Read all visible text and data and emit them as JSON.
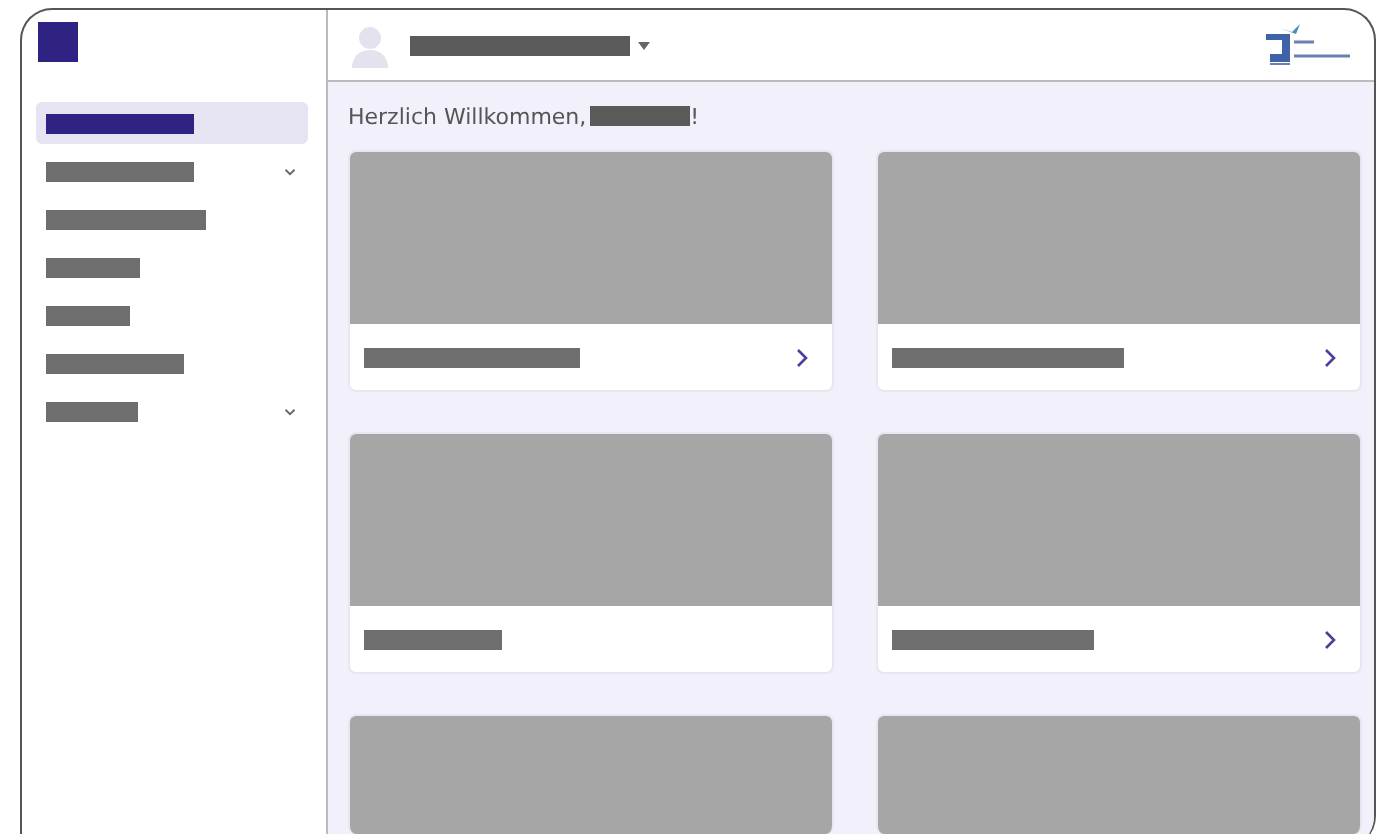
{
  "sidebar": {
    "items": [
      {
        "selected": true,
        "expandable": false
      },
      {
        "selected": false,
        "expandable": true
      },
      {
        "selected": false,
        "expandable": false
      },
      {
        "selected": false,
        "expandable": false
      },
      {
        "selected": false,
        "expandable": false
      },
      {
        "selected": false,
        "expandable": false
      },
      {
        "selected": false,
        "expandable": true
      }
    ]
  },
  "greeting": {
    "text": "Herzlich Willkommen,",
    "end": "!"
  },
  "cards": [
    {
      "kind": "full",
      "link": true
    },
    {
      "kind": "full",
      "link": true
    },
    {
      "kind": "full",
      "link": false
    },
    {
      "kind": "full",
      "link": true
    },
    {
      "kind": "cut"
    },
    {
      "kind": "cut"
    }
  ]
}
